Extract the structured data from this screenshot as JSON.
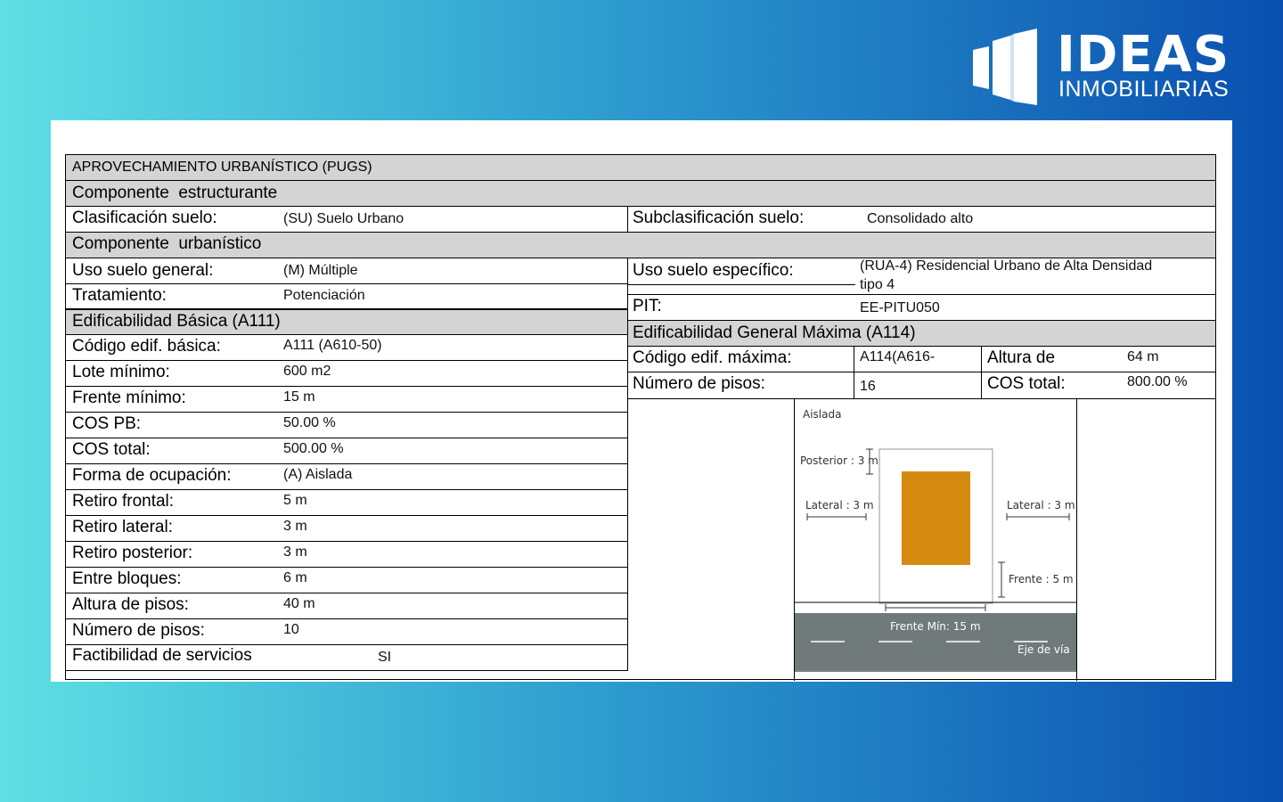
{
  "brand": {
    "name": "IDEAS",
    "tagline": "INMOBILIARIAS",
    "logo_icon": "building-icon"
  },
  "table": {
    "title": "APROVECHAMIENTO URBANÍSTICO (PUGS)",
    "componente_estructurante": {
      "header": "Componente  estructurante",
      "clasificacion_label": "Clasificación suelo:",
      "clasificacion_value": "(SU) Suelo Urbano",
      "subclasificacion_label": "Subclasificación suelo:",
      "subclasificacion_value": "Consolidado alto"
    },
    "componente_urbanistico": {
      "header": "Componente  urbanístico",
      "uso_general_label": "Uso suelo general:",
      "uso_general_value": "(M) Múltiple",
      "tratamiento_label": "Tratamiento:",
      "tratamiento_value": "Potenciación",
      "uso_especifico_label": "Uso suelo específico:",
      "uso_especifico_value_line1": "(RUA-4) Residencial Urbano de Alta Densidad",
      "uso_especifico_value_line2": "tipo 4",
      "pit_label": "PIT:",
      "pit_value": "EE-PITU050"
    },
    "basica": {
      "header": "Edificabilidad Básica (A111)",
      "rows": [
        {
          "label": "Código edif. básica:",
          "value": "A111 (A610-50)"
        },
        {
          "label": "Lote mínimo:",
          "value": "600 m2"
        },
        {
          "label": "Frente mínimo:",
          "value": "15 m"
        },
        {
          "label": "COS PB:",
          "value": "50.00 %"
        },
        {
          "label": "COS total:",
          "value": "500.00 %"
        },
        {
          "label": "Forma de ocupación:",
          "value": "(A) Aislada"
        },
        {
          "label": "Retiro frontal:",
          "value": "5 m"
        },
        {
          "label": "Retiro lateral:",
          "value": "3 m"
        },
        {
          "label": "Retiro posterior:",
          "value": "3 m"
        },
        {
          "label": "Entre bloques:",
          "value": "6 m"
        },
        {
          "label": "Altura de pisos:",
          "value": "40 m"
        },
        {
          "label": "Número de pisos:",
          "value": "10"
        }
      ],
      "factibilidad_label": "Factibilidad de servicios",
      "factibilidad_value": "SI"
    },
    "maxima": {
      "header": "Edificabilidad General Máxima (A114)",
      "codigo_label": "Código edif. máxima:",
      "codigo_value": "A114(A616-",
      "altura_label": "Altura de",
      "altura_value": "64 m",
      "pisos_label": "Número de pisos:",
      "pisos_value": "16",
      "cos_label": "COS total:",
      "cos_value": "800.00 %"
    },
    "diagram": {
      "title": "Aislada",
      "posterior": "Posterior : 3 m",
      "lateral_left": "Lateral : 3 m",
      "lateral_right": "Lateral : 3 m",
      "frente": "Frente : 5 m",
      "frente_min": "Frente Mín: 15 m",
      "eje_via": "Eje de vía",
      "building_color": "#d68910",
      "road_color": "#707a7a"
    }
  }
}
